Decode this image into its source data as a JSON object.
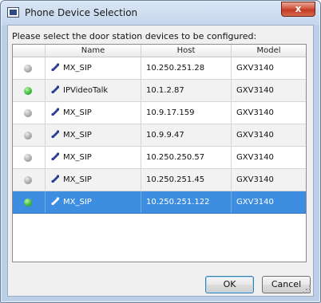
{
  "window": {
    "title": "Phone Device Selection",
    "close_label": "x"
  },
  "prompt": "Please select the door station devices to be configured:",
  "table": {
    "columns": [
      "",
      "Name",
      "Host",
      "Model"
    ],
    "rows": [
      {
        "status": "gray",
        "name": "MX_SIP",
        "host": "10.250.251.28",
        "model": "GXV3140",
        "selected": false
      },
      {
        "status": "green",
        "name": "IPVideoTalk",
        "host": "10.1.2.87",
        "model": "GXV3140",
        "selected": false
      },
      {
        "status": "gray",
        "name": "MX_SIP",
        "host": "10.9.17.159",
        "model": "GXV3140",
        "selected": false
      },
      {
        "status": "gray",
        "name": "MX_SIP",
        "host": "10.9.9.47",
        "model": "GXV3140",
        "selected": false
      },
      {
        "status": "gray",
        "name": "MX_SIP",
        "host": "10.250.250.57",
        "model": "GXV3140",
        "selected": false
      },
      {
        "status": "gray",
        "name": "MX_SIP",
        "host": "10.250.251.45",
        "model": "GXV3140",
        "selected": false
      },
      {
        "status": "green",
        "name": "MX_SIP",
        "host": "10.250.251.122",
        "model": "GXV3140",
        "selected": true
      }
    ]
  },
  "buttons": {
    "ok": "OK",
    "cancel": "Cancel"
  },
  "icons": {
    "status_icon": "status-dot-icon",
    "device_icon": "phone-handset-icon",
    "app_icon": "window-app-icon"
  },
  "colors": {
    "selection": "#3d8ee0",
    "online": "#3bb83b",
    "offline": "#a8a8a8",
    "close": "#c13a22"
  }
}
